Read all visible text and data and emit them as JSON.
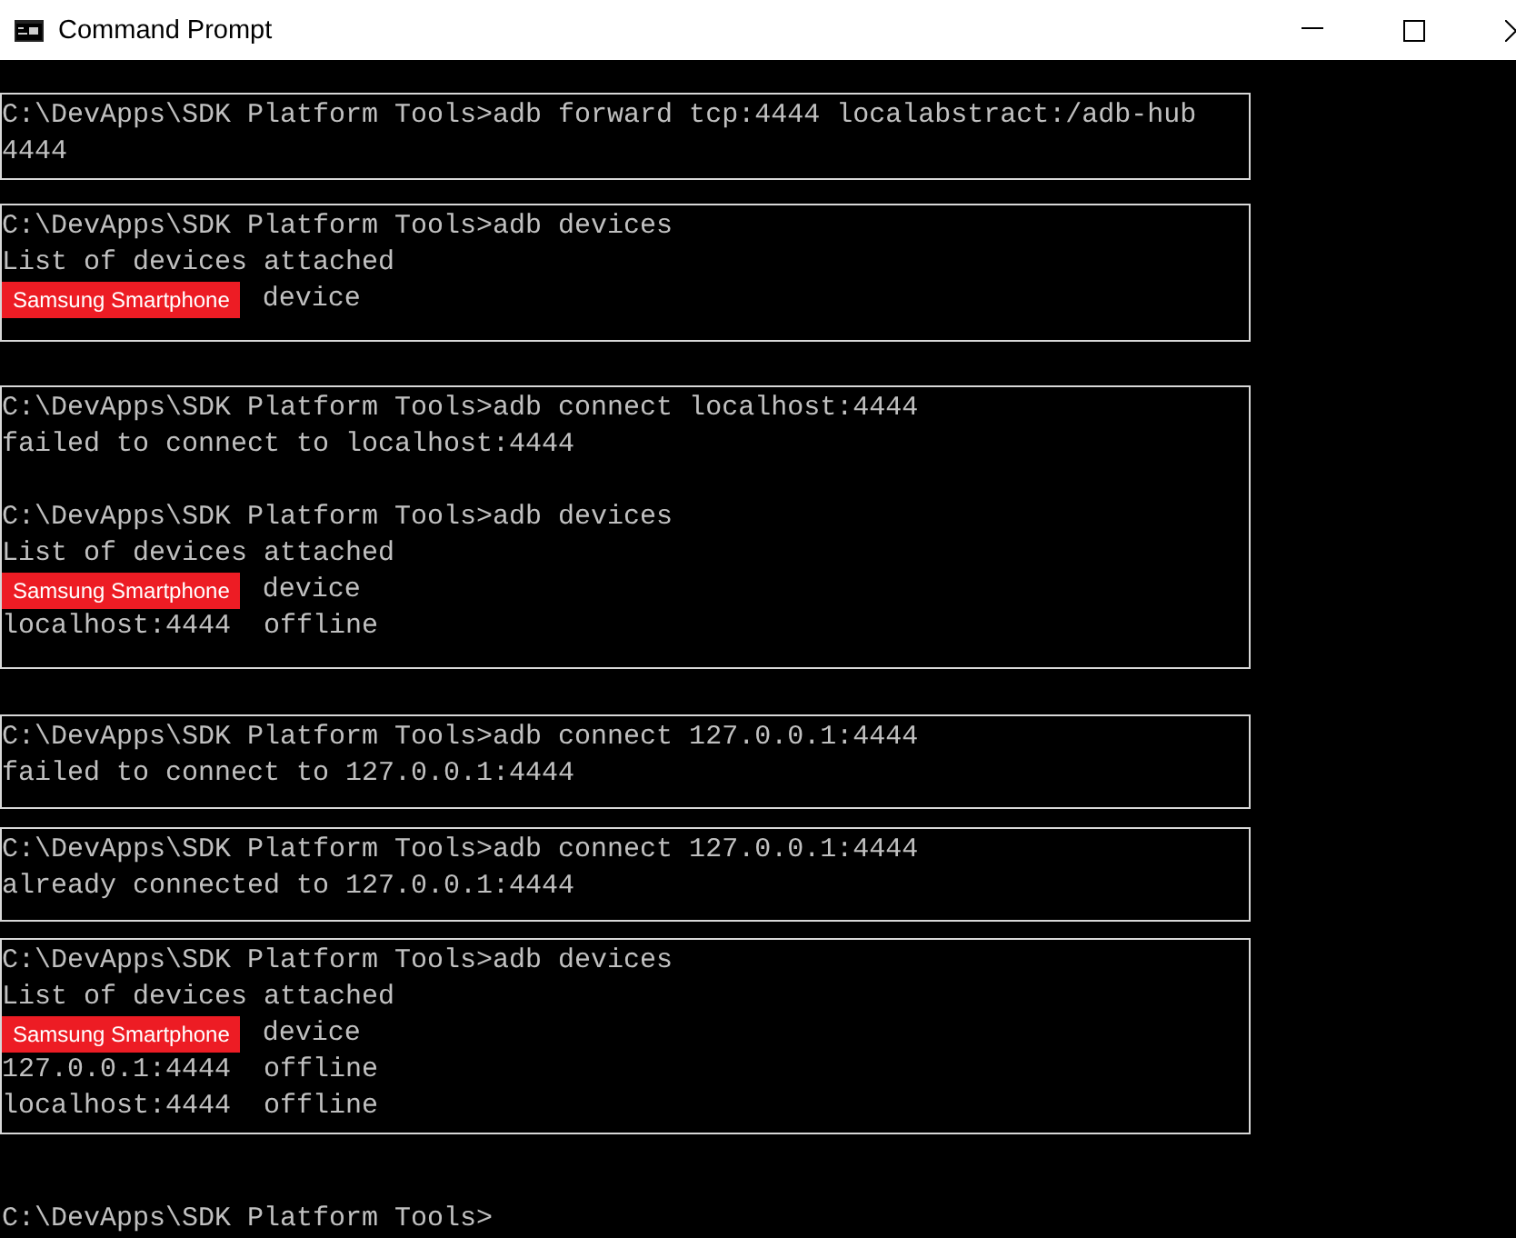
{
  "window": {
    "title": "Command Prompt"
  },
  "console": {
    "blocks": [
      {
        "boxed": true,
        "entries": [
          {
            "lines": [
              {
                "text": "C:\\DevApps\\SDK Platform Tools>adb forward tcp:4444 localabstract:/adb-hub"
              },
              {
                "text": "4444"
              }
            ]
          }
        ]
      },
      {
        "boxed": true,
        "entries": [
          {
            "lines": [
              {
                "text": "C:\\DevApps\\SDK Platform Tools>adb devices"
              },
              {
                "text": "List of devices attached"
              },
              {
                "label": "Samsung Smartphone",
                "text": "device"
              }
            ]
          }
        ]
      },
      {
        "boxed": true,
        "entries": [
          {
            "lines": [
              {
                "text": "C:\\DevApps\\SDK Platform Tools>adb connect localhost:4444"
              },
              {
                "text": "failed to connect to localhost:4444"
              }
            ]
          },
          {
            "lines": [
              {
                "text": "C:\\DevApps\\SDK Platform Tools>adb devices"
              },
              {
                "text": "List of devices attached"
              },
              {
                "label": "Samsung Smartphone",
                "text": "device"
              },
              {
                "text": "localhost:4444  offline"
              }
            ]
          }
        ]
      },
      {
        "boxed": true,
        "entries": [
          {
            "lines": [
              {
                "text": "C:\\DevApps\\SDK Platform Tools>adb connect 127.0.0.1:4444"
              },
              {
                "text": "failed to connect to 127.0.0.1:4444"
              }
            ]
          }
        ]
      },
      {
        "boxed": true,
        "entries": [
          {
            "lines": [
              {
                "text": "C:\\DevApps\\SDK Platform Tools>adb connect 127.0.0.1:4444"
              },
              {
                "text": "already connected to 127.0.0.1:4444"
              }
            ]
          }
        ]
      },
      {
        "boxed": true,
        "entries": [
          {
            "lines": [
              {
                "text": "C:\\DevApps\\SDK Platform Tools>adb devices"
              },
              {
                "text": "List of devices attached"
              },
              {
                "label": "Samsung Smartphone",
                "text": "device"
              },
              {
                "text": "127.0.0.1:4444  offline"
              },
              {
                "text": "localhost:4444  offline"
              }
            ]
          }
        ]
      },
      {
        "boxed": false,
        "entries": [
          {
            "lines": [
              {
                "text": "C:\\DevApps\\SDK Platform Tools>"
              }
            ]
          }
        ]
      }
    ]
  }
}
